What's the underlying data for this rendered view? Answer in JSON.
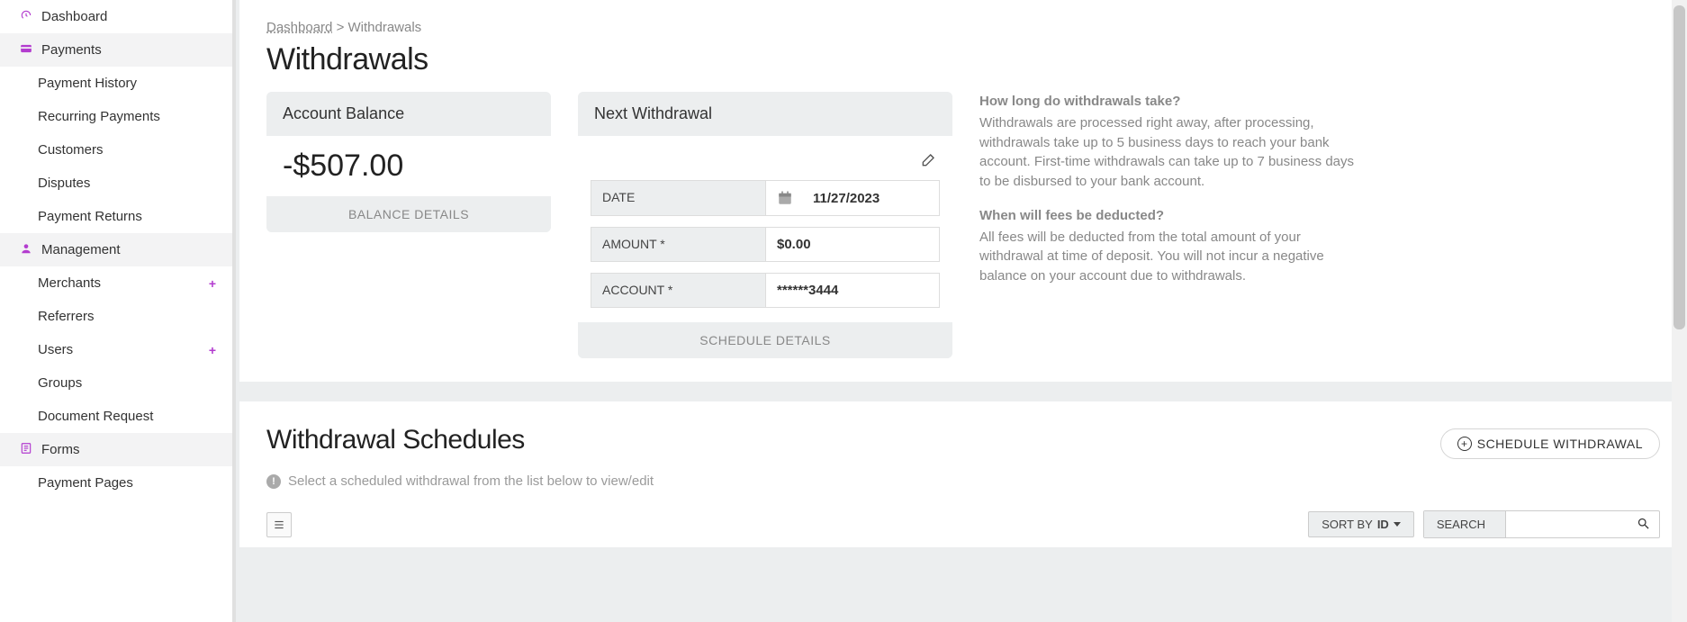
{
  "breadcrumb": {
    "root": "Dashboard",
    "sep": ">",
    "current": "Withdrawals"
  },
  "page_title": "Withdrawals",
  "sidebar": {
    "dashboard": "Dashboard",
    "payments": {
      "label": "Payments",
      "items": [
        "Payment History",
        "Recurring Payments",
        "Customers",
        "Disputes",
        "Payment Returns"
      ]
    },
    "management": {
      "label": "Management",
      "items": [
        "Merchants",
        "Referrers",
        "Users",
        "Groups",
        "Document Request"
      ],
      "plus_indices": [
        0,
        2
      ]
    },
    "forms": {
      "label": "Forms",
      "items": [
        "Payment Pages"
      ]
    }
  },
  "balance": {
    "header": "Account Balance",
    "amount": "-$507.00",
    "footer": "BALANCE DETAILS"
  },
  "next": {
    "header": "Next Withdrawal",
    "rows": {
      "date_label": "DATE",
      "date_value": "11/27/2023",
      "amount_label": "AMOUNT *",
      "amount_value": "$0.00",
      "account_label": "ACCOUNT *",
      "account_value": "******3444"
    },
    "footer": "SCHEDULE DETAILS"
  },
  "info": {
    "q1": "How long do withdrawals take?",
    "a1": "Withdrawals are processed right away, after processing, withdrawals take up to 5 business days to reach your bank account. First-time withdrawals can take up to 7 business days to be disbursed to your bank account.",
    "q2": "When will fees be deducted?",
    "a2": "All fees will be deducted from the total amount of your withdrawal at time of deposit. You will not incur a negative balance on your account due to withdrawals."
  },
  "schedules": {
    "title": "Withdrawal Schedules",
    "button": "SCHEDULE WITHDRAWAL",
    "hint": "Select a scheduled withdrawal from the list below to view/edit",
    "sort_prefix": "SORT BY",
    "sort_field": "ID",
    "search_label": "SEARCH"
  }
}
